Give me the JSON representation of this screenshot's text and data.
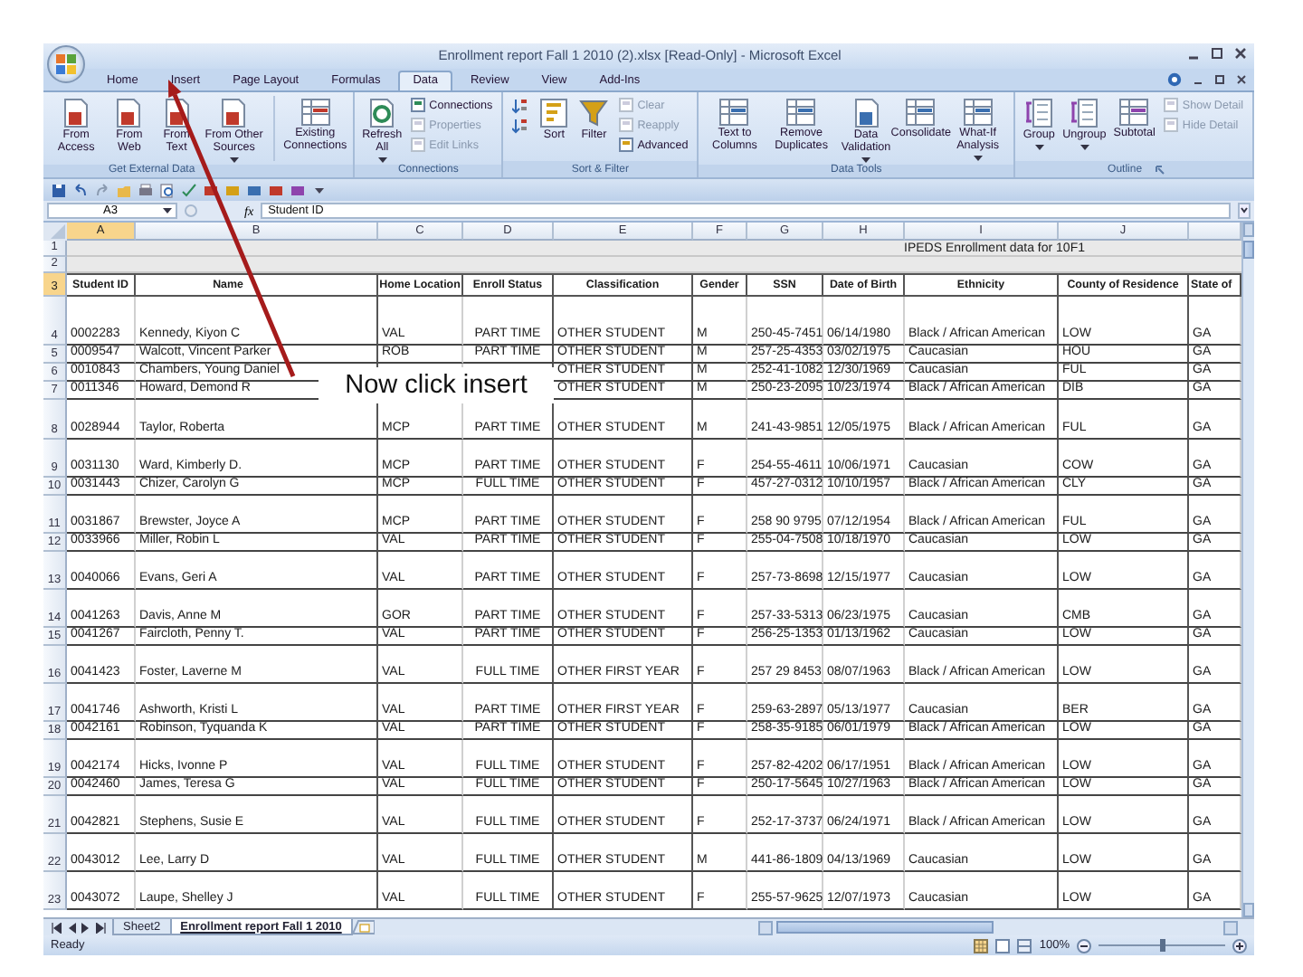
{
  "window": {
    "title": "Enrollment report Fall 1 2010 (2).xlsx  [Read-Only] - Microsoft Excel"
  },
  "ribbon": {
    "tabs": [
      {
        "label": "Home",
        "selected": false
      },
      {
        "label": "Insert",
        "selected": false
      },
      {
        "label": "Page Layout",
        "selected": false
      },
      {
        "label": "Formulas",
        "selected": false
      },
      {
        "label": "Data",
        "selected": true
      },
      {
        "label": "Review",
        "selected": false
      },
      {
        "label": "View",
        "selected": false
      },
      {
        "label": "Add-Ins",
        "selected": false
      }
    ],
    "groups": [
      {
        "label": "Get External Data",
        "launcher": false,
        "buttons": [
          {
            "kind": "large",
            "label": "From Access",
            "disabled": false,
            "dropdown": false
          },
          {
            "kind": "large",
            "label": "From Web",
            "disabled": false,
            "dropdown": false
          },
          {
            "kind": "large",
            "label": "From Text",
            "disabled": false,
            "dropdown": false
          },
          {
            "kind": "large",
            "label": "From Other Sources",
            "disabled": false,
            "dropdown": true
          },
          {
            "kind": "large",
            "label": "Existing Connections",
            "disabled": false,
            "dropdown": false
          }
        ]
      },
      {
        "label": "Connections",
        "launcher": false,
        "buttons": [
          {
            "kind": "large",
            "label": "Refresh All",
            "disabled": false,
            "dropdown": true
          },
          {
            "kind": "small",
            "label": "Connections",
            "disabled": false,
            "dropdown": false
          },
          {
            "kind": "small",
            "label": "Properties",
            "disabled": true,
            "dropdown": false
          },
          {
            "kind": "small",
            "label": "Edit Links",
            "disabled": true,
            "dropdown": false
          }
        ]
      },
      {
        "label": "Sort & Filter",
        "launcher": false,
        "buttons": [
          {
            "kind": "sort",
            "disabled": false,
            "dropdown": false
          },
          {
            "kind": "sort",
            "disabled": false,
            "dropdown": false
          },
          {
            "kind": "large",
            "label": "Sort",
            "disabled": false,
            "dropdown": false
          },
          {
            "kind": "large",
            "label": "Filter",
            "disabled": false,
            "dropdown": false
          },
          {
            "kind": "small",
            "label": "Clear",
            "disabled": true,
            "dropdown": false
          },
          {
            "kind": "small",
            "label": "Reapply",
            "disabled": true,
            "dropdown": false
          },
          {
            "kind": "small",
            "label": "Advanced",
            "disabled": false,
            "dropdown": false
          }
        ]
      },
      {
        "label": "Data Tools",
        "launcher": false,
        "buttons": [
          {
            "kind": "large",
            "label": "Text to Columns",
            "disabled": false,
            "dropdown": false
          },
          {
            "kind": "large",
            "label": "Remove Duplicates",
            "disabled": false,
            "dropdown": false
          },
          {
            "kind": "large",
            "label": "Data Validation",
            "disabled": false,
            "dropdown": true
          },
          {
            "kind": "large",
            "label": "Consolidate",
            "disabled": false,
            "dropdown": false
          },
          {
            "kind": "large",
            "label": "What-If Analysis",
            "disabled": false,
            "dropdown": true
          }
        ]
      },
      {
        "label": "Outline",
        "launcher": true,
        "buttons": [
          {
            "kind": "large",
            "label": "Group",
            "disabled": false,
            "dropdown": true
          },
          {
            "kind": "large",
            "label": "Ungroup",
            "disabled": false,
            "dropdown": true
          },
          {
            "kind": "large",
            "label": "Subtotal",
            "disabled": false,
            "dropdown": false
          },
          {
            "kind": "small",
            "label": "Show Detail",
            "disabled": true,
            "dropdown": false
          },
          {
            "kind": "small",
            "label": "Hide Detail",
            "disabled": true,
            "dropdown": false
          }
        ]
      }
    ]
  },
  "formula_bar": {
    "name_box": "A3",
    "function_label": "fx",
    "formula": "Student ID"
  },
  "sheet": {
    "columns": [
      {
        "letter": "A",
        "selected": true
      },
      {
        "letter": "B",
        "selected": false
      },
      {
        "letter": "C",
        "selected": false
      },
      {
        "letter": "D",
        "selected": false
      },
      {
        "letter": "E",
        "selected": false
      },
      {
        "letter": "F",
        "selected": false
      },
      {
        "letter": "G",
        "selected": false
      },
      {
        "letter": "H",
        "selected": false
      },
      {
        "letter": "I",
        "selected": false
      },
      {
        "letter": "J",
        "selected": false
      }
    ],
    "title_row": {
      "number": "1",
      "selected": false,
      "text": "IPEDS Enrollment data for 10F1"
    },
    "blank_row": {
      "number": "2",
      "selected": false
    },
    "header_row": {
      "number": "3",
      "selected": true,
      "cells": [
        "Student ID",
        "Name",
        "Home Location",
        "Enroll Status",
        "Classification",
        "Gender",
        "SSN",
        "Date of Birth",
        "Ethnicity",
        "County of Residence",
        "State of"
      ]
    },
    "rows": [
      {
        "number": "4",
        "selected": false,
        "cells": [
          "0002283",
          "Kennedy, Kiyon C",
          "VAL",
          "PART TIME",
          "OTHER STUDENT",
          "M",
          "250-45-7451",
          "06/14/1980",
          "Black / African American",
          "LOW",
          "GA"
        ]
      },
      {
        "number": "5",
        "selected": false,
        "cells": [
          "0009547",
          "Walcott, Vincent Parker",
          "ROB",
          "PART TIME",
          "OTHER STUDENT",
          "M",
          "257-25-4353",
          "03/02/1975",
          "Caucasian",
          "HOU",
          "GA"
        ]
      },
      {
        "number": "6",
        "selected": false,
        "cells": [
          "0010843",
          "Chambers, Young Daniel",
          null,
          null,
          "OTHER STUDENT",
          "M",
          "252-41-1082",
          "12/30/1969",
          "Caucasian",
          "FUL",
          "GA"
        ]
      },
      {
        "number": "7",
        "selected": false,
        "cells": [
          "0011346",
          "Howard, Demond R",
          null,
          null,
          "OTHER STUDENT",
          "M",
          "250-23-2095",
          "10/23/1974",
          "Black / African American",
          "DIB",
          "GA"
        ]
      },
      {
        "number": "8",
        "selected": false,
        "cells": [
          "0028944",
          "Taylor, Roberta",
          "MCP",
          "PART TIME",
          "OTHER STUDENT",
          "M",
          "241-43-9851",
          "12/05/1975",
          "Black / African American",
          "FUL",
          "GA"
        ]
      },
      {
        "number": "9",
        "selected": false,
        "cells": [
          "0031130",
          "Ward, Kimberly D.",
          "MCP",
          "PART TIME",
          "OTHER STUDENT",
          "F",
          "254-55-4611",
          "10/06/1971",
          "Caucasian",
          "COW",
          "GA"
        ]
      },
      {
        "number": "10",
        "selected": false,
        "cells": [
          "0031443",
          "Chizer, Carolyn G",
          "MCP",
          "FULL TIME",
          "OTHER STUDENT",
          "F",
          "457-27-0312",
          "10/10/1957",
          "Black / African American",
          "CLY",
          "GA"
        ]
      },
      {
        "number": "11",
        "selected": false,
        "cells": [
          "0031867",
          "Brewster, Joyce A",
          "MCP",
          "PART TIME",
          "OTHER STUDENT",
          "F",
          "258 90 9795",
          "07/12/1954",
          "Black / African American",
          "FUL",
          "GA"
        ]
      },
      {
        "number": "12",
        "selected": false,
        "cells": [
          "0033966",
          "Miller, Robin L",
          "VAL",
          "PART TIME",
          "OTHER STUDENT",
          "F",
          "255-04-7508",
          "10/18/1970",
          "Caucasian",
          "LOW",
          "GA"
        ]
      },
      {
        "number": "13",
        "selected": false,
        "cells": [
          "0040066",
          "Evans, Geri A",
          "VAL",
          "PART TIME",
          "OTHER STUDENT",
          "F",
          "257-73-8698",
          "12/15/1977",
          "Caucasian",
          "LOW",
          "GA"
        ]
      },
      {
        "number": "14",
        "selected": false,
        "cells": [
          "0041263",
          "Davis, Anne M",
          "GOR",
          "PART TIME",
          "OTHER STUDENT",
          "F",
          "257-33-5313",
          "06/23/1975",
          "Caucasian",
          "CMB",
          "GA"
        ]
      },
      {
        "number": "15",
        "selected": false,
        "cells": [
          "0041267",
          "Faircloth, Penny T.",
          "VAL",
          "PART TIME",
          "OTHER STUDENT",
          "F",
          "256-25-1353",
          "01/13/1962",
          "Caucasian",
          "LOW",
          "GA"
        ]
      },
      {
        "number": "16",
        "selected": false,
        "cells": [
          "0041423",
          "Foster, Laverne M",
          "VAL",
          "FULL TIME",
          "OTHER FIRST YEAR",
          "F",
          "257 29 8453",
          "08/07/1963",
          "Black / African American",
          "LOW",
          "GA"
        ]
      },
      {
        "number": "17",
        "selected": false,
        "cells": [
          "0041746",
          "Ashworth, Kristi L",
          "VAL",
          "PART TIME",
          "OTHER FIRST YEAR",
          "F",
          "259-63-2897",
          "05/13/1977",
          "Caucasian",
          "BER",
          "GA"
        ]
      },
      {
        "number": "18",
        "selected": false,
        "cells": [
          "0042161",
          "Robinson, Tyquanda K",
          "VAL",
          "PART TIME",
          "OTHER STUDENT",
          "F",
          "258-35-9185",
          "06/01/1979",
          "Black / African American",
          "LOW",
          "GA"
        ]
      },
      {
        "number": "19",
        "selected": false,
        "cells": [
          "0042174",
          "Hicks, Ivonne P",
          "VAL",
          "FULL TIME",
          "OTHER STUDENT",
          "F",
          "257-82-4202",
          "06/17/1951",
          "Black / African American",
          "LOW",
          "GA"
        ]
      },
      {
        "number": "20",
        "selected": false,
        "cells": [
          "0042460",
          "James, Teresa G",
          "VAL",
          "FULL TIME",
          "OTHER STUDENT",
          "F",
          "250-17-5645",
          "10/27/1963",
          "Black / African American",
          "LOW",
          "GA"
        ]
      },
      {
        "number": "21",
        "selected": false,
        "cells": [
          "0042821",
          "Stephens, Susie E",
          "VAL",
          "FULL TIME",
          "OTHER STUDENT",
          "F",
          "252-17-3737",
          "06/24/1971",
          "Black / African American",
          "LOW",
          "GA"
        ]
      },
      {
        "number": "22",
        "selected": false,
        "cells": [
          "0043012",
          "Lee, Larry D",
          "VAL",
          "FULL TIME",
          "OTHER STUDENT",
          "M",
          "441-86-1809",
          "04/13/1969",
          "Caucasian",
          "LOW",
          "GA"
        ]
      },
      {
        "number": "23",
        "selected": false,
        "cells": [
          "0043072",
          "Laupe, Shelley J",
          "VAL",
          "FULL TIME",
          "OTHER STUDENT",
          "F",
          "255-57-9625",
          "12/07/1973",
          "Caucasian",
          "LOW",
          "GA"
        ]
      }
    ]
  },
  "sheet_tabs": [
    {
      "label": "Sheet2",
      "selected": false
    },
    {
      "label": "Enrollment report Fall 1 2010",
      "selected": true
    }
  ],
  "status_bar": {
    "status": "Ready",
    "zoom": "100%",
    "zoom_slider": {
      "level": 0.5
    }
  },
  "callout": {
    "text": "Now click insert"
  }
}
